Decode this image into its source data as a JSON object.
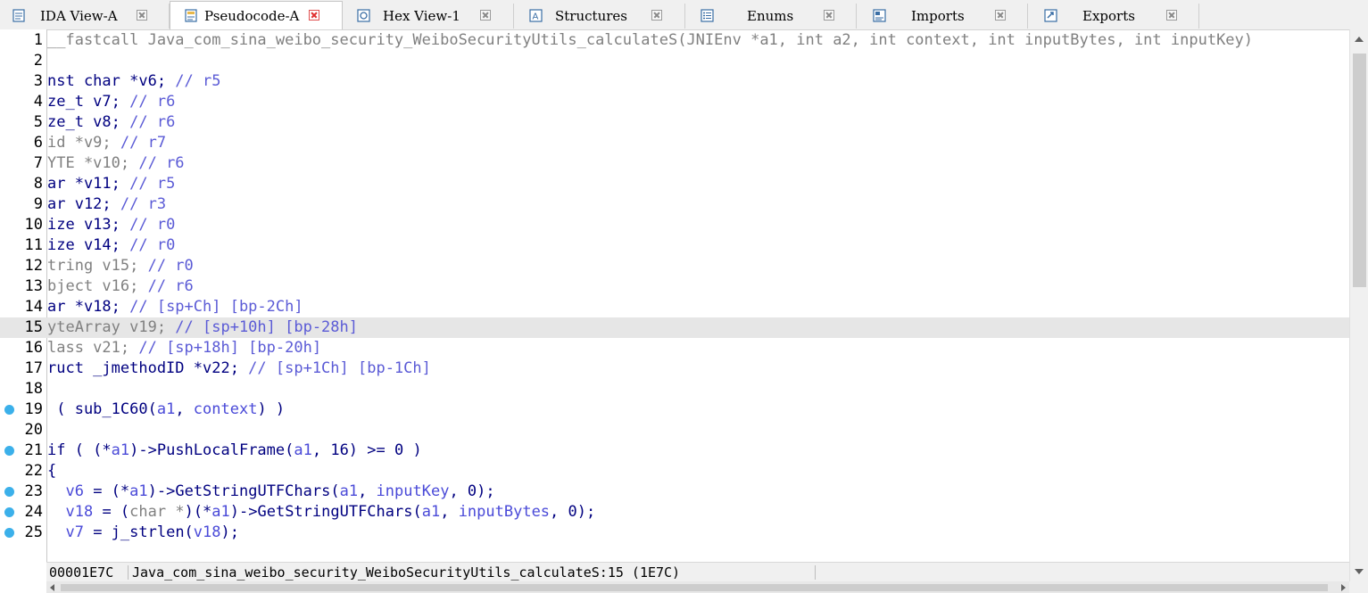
{
  "tabs": [
    {
      "label": "IDA View-A",
      "icon": "ida-view-icon"
    },
    {
      "label": "Pseudocode-A",
      "icon": "pseudocode-icon"
    },
    {
      "label": "Hex View-1",
      "icon": "hex-view-icon"
    },
    {
      "label": "Structures",
      "icon": "structures-icon"
    },
    {
      "label": "Enums",
      "icon": "enums-icon"
    },
    {
      "label": "Imports",
      "icon": "imports-icon"
    },
    {
      "label": "Exports",
      "icon": "exports-icon"
    }
  ],
  "active_tab": "Pseudocode-A",
  "code_lines": [
    {
      "num": "1",
      "bp": false,
      "hl": false,
      "tokens": [
        [
          "t",
          "__fastcall Java_com_sina_weibo_security_WeiboSecurityUtils_calculateS(JNIEnv *a1, int a2, int context, int inputBytes, int inputKey)"
        ]
      ]
    },
    {
      "num": "2",
      "bp": false,
      "hl": false,
      "tokens": []
    },
    {
      "num": "3",
      "bp": false,
      "hl": false,
      "tokens": [
        [
          "k",
          "nst char *v6; "
        ],
        [
          "c",
          "// r5"
        ]
      ]
    },
    {
      "num": "4",
      "bp": false,
      "hl": false,
      "tokens": [
        [
          "k",
          "ze_t v7; "
        ],
        [
          "c",
          "// r6"
        ]
      ]
    },
    {
      "num": "5",
      "bp": false,
      "hl": false,
      "tokens": [
        [
          "k",
          "ze_t v8; "
        ],
        [
          "c",
          "// r6"
        ]
      ]
    },
    {
      "num": "6",
      "bp": false,
      "hl": false,
      "tokens": [
        [
          "t",
          "id *v9; "
        ],
        [
          "c",
          "// r7"
        ]
      ]
    },
    {
      "num": "7",
      "bp": false,
      "hl": false,
      "tokens": [
        [
          "t",
          "YTE *v10; "
        ],
        [
          "c",
          "// r6"
        ]
      ]
    },
    {
      "num": "8",
      "bp": false,
      "hl": false,
      "tokens": [
        [
          "k",
          "ar *v11; "
        ],
        [
          "c",
          "// r5"
        ]
      ]
    },
    {
      "num": "9",
      "bp": false,
      "hl": false,
      "tokens": [
        [
          "k",
          "ar v12; "
        ],
        [
          "c",
          "// r3"
        ]
      ]
    },
    {
      "num": "10",
      "bp": false,
      "hl": false,
      "tokens": [
        [
          "k",
          "ize v13; "
        ],
        [
          "c",
          "// r0"
        ]
      ]
    },
    {
      "num": "11",
      "bp": false,
      "hl": false,
      "tokens": [
        [
          "k",
          "ize v14; "
        ],
        [
          "c",
          "// r0"
        ]
      ]
    },
    {
      "num": "12",
      "bp": false,
      "hl": false,
      "tokens": [
        [
          "t",
          "tring v15; "
        ],
        [
          "c",
          "// r0"
        ]
      ]
    },
    {
      "num": "13",
      "bp": false,
      "hl": false,
      "tokens": [
        [
          "t",
          "bject v16; "
        ],
        [
          "c",
          "// r6"
        ]
      ]
    },
    {
      "num": "14",
      "bp": false,
      "hl": false,
      "tokens": [
        [
          "k",
          "ar *v18; "
        ],
        [
          "c",
          "// [sp+Ch] [bp-2Ch]"
        ]
      ]
    },
    {
      "num": "15",
      "bp": false,
      "hl": true,
      "tokens": [
        [
          "t",
          "yteArray v19; "
        ],
        [
          "c",
          "// [sp+10h] [bp-28h]"
        ]
      ]
    },
    {
      "num": "16",
      "bp": false,
      "hl": false,
      "tokens": [
        [
          "t",
          "lass v21; "
        ],
        [
          "c",
          "// [sp+18h] [bp-20h]"
        ]
      ]
    },
    {
      "num": "17",
      "bp": false,
      "hl": false,
      "tokens": [
        [
          "k",
          "ruct _jmethodID *v22; "
        ],
        [
          "c",
          "// [sp+1Ch] [bp-1Ch]"
        ]
      ]
    },
    {
      "num": "18",
      "bp": false,
      "hl": false,
      "tokens": []
    },
    {
      "num": "19",
      "bp": true,
      "hl": false,
      "tokens": [
        [
          "k",
          " ( sub_1C60("
        ],
        [
          "v",
          "a1"
        ],
        [
          "k",
          ", "
        ],
        [
          "v",
          "context"
        ],
        [
          "k",
          ") )"
        ]
      ]
    },
    {
      "num": "20",
      "bp": false,
      "hl": false,
      "tokens": []
    },
    {
      "num": "21",
      "bp": true,
      "hl": false,
      "tokens": [
        [
          "k",
          "if ( (*"
        ],
        [
          "v",
          "a1"
        ],
        [
          "k",
          ")->PushLocalFrame("
        ],
        [
          "v",
          "a1"
        ],
        [
          "k",
          ", 16) >= 0 )"
        ]
      ]
    },
    {
      "num": "22",
      "bp": false,
      "hl": false,
      "tokens": [
        [
          "k",
          "{"
        ]
      ]
    },
    {
      "num": "23",
      "bp": true,
      "hl": false,
      "tokens": [
        [
          "k",
          "  "
        ],
        [
          "v",
          "v6"
        ],
        [
          "k",
          " = (*"
        ],
        [
          "v",
          "a1"
        ],
        [
          "k",
          ")->GetStringUTFChars("
        ],
        [
          "v",
          "a1"
        ],
        [
          "k",
          ", "
        ],
        [
          "v",
          "inputKey"
        ],
        [
          "k",
          ", 0);"
        ]
      ]
    },
    {
      "num": "24",
      "bp": true,
      "hl": false,
      "tokens": [
        [
          "k",
          "  "
        ],
        [
          "v",
          "v18"
        ],
        [
          "k",
          " = ("
        ],
        [
          "t",
          "char *"
        ],
        [
          "k",
          ")(*"
        ],
        [
          "v",
          "a1"
        ],
        [
          "k",
          ")->GetStringUTFChars("
        ],
        [
          "v",
          "a1"
        ],
        [
          "k",
          ", "
        ],
        [
          "v",
          "inputBytes"
        ],
        [
          "k",
          ", 0);"
        ]
      ]
    },
    {
      "num": "25",
      "bp": true,
      "hl": false,
      "tokens": [
        [
          "k",
          "  "
        ],
        [
          "v",
          "v7"
        ],
        [
          "k",
          " = j_strlen("
        ],
        [
          "v",
          "v18"
        ],
        [
          "k",
          ");"
        ]
      ]
    }
  ],
  "status": {
    "address": "00001E7C",
    "location": "Java_com_sina_weibo_security_WeiboSecurityUtils_calculateS:15 (1E7C)"
  },
  "colors": {
    "keyword_text": "#000080",
    "variable_text": "#4a4ad8",
    "comment_text": "#5b5bd6",
    "type_text": "#808080",
    "breakpoint": "#3bb0ea",
    "highlight_line": "#e6e6e6"
  }
}
